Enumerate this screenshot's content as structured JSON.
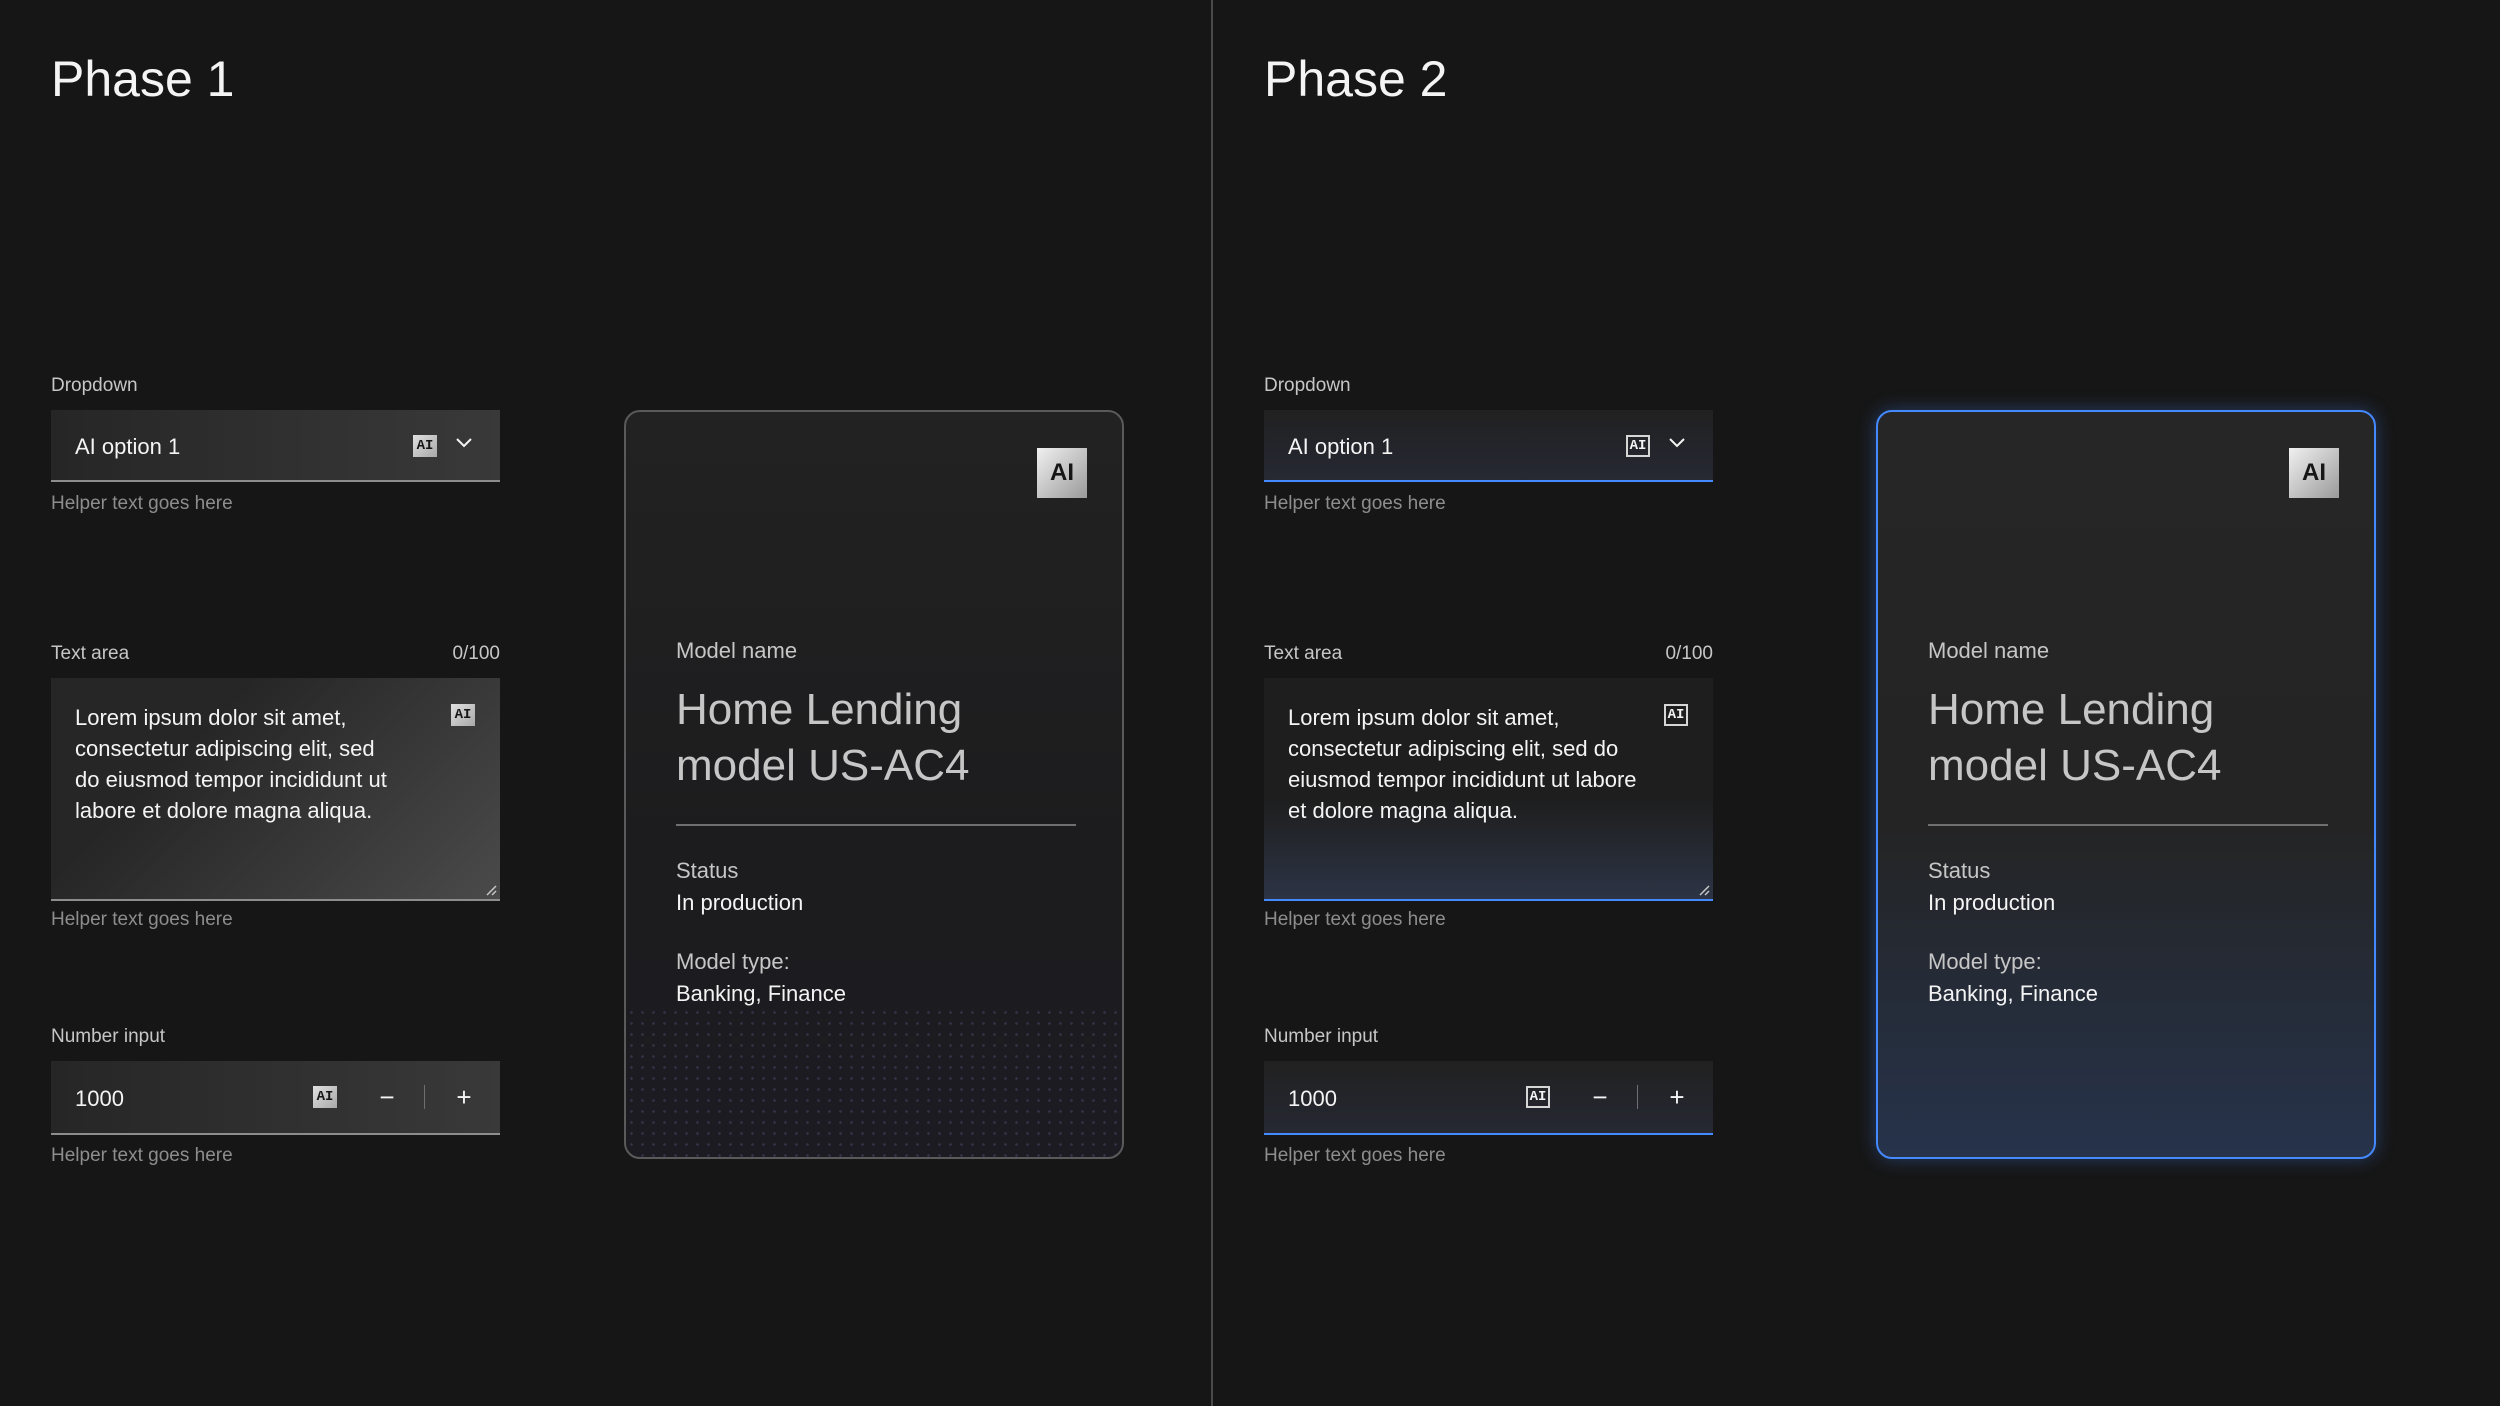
{
  "phases": [
    {
      "title": "Phase 1",
      "dropdown": {
        "label": "Dropdown",
        "value": "AI option 1",
        "ai": "AI",
        "helper": "Helper text goes here"
      },
      "textarea": {
        "label": "Text area",
        "counter": "0/100",
        "value": "Lorem ipsum dolor sit amet, consectetur adipiscing elit, sed do eiusmod tempor incididunt ut labore et dolore magna aliqua.",
        "ai": "AI",
        "helper": "Helper text goes here"
      },
      "number": {
        "label": "Number input",
        "value": "1000",
        "ai": "AI",
        "minus": "−",
        "plus": "+",
        "helper": "Helper text goes here"
      },
      "tile": {
        "ai": "AI",
        "name_label": "Model name",
        "name_value": "Home Lending model US-AC4",
        "status_label": "Status",
        "status_value": "In production",
        "type_label": "Model type:",
        "type_value": "Banking, Finance"
      }
    },
    {
      "title": "Phase 2",
      "dropdown": {
        "label": "Dropdown",
        "value": "AI option 1",
        "ai": "AI",
        "helper": "Helper text goes here"
      },
      "textarea": {
        "label": "Text area",
        "counter": "0/100",
        "value": "Lorem ipsum dolor sit amet, consectetur adipiscing elit, sed do eiusmod tempor incididunt ut labore et dolore magna aliqua.",
        "ai": "AI",
        "helper": "Helper text goes here"
      },
      "number": {
        "label": "Number input",
        "value": "1000",
        "ai": "AI",
        "minus": "−",
        "plus": "+",
        "helper": "Helper text goes here"
      },
      "tile": {
        "ai": "AI",
        "name_label": "Model name",
        "name_value": "Home Lending model US-AC4",
        "status_label": "Status",
        "status_value": "In production",
        "type_label": "Model type:",
        "type_value": "Banking, Finance"
      }
    }
  ],
  "colors": {
    "background": "#161616",
    "accent": "#4589ff",
    "divider": "#4a4a4a"
  },
  "icons": {
    "dropdown": "chevron-down-icon",
    "textarea": "resize-handle-icon",
    "badge": "ai-label-icon"
  }
}
